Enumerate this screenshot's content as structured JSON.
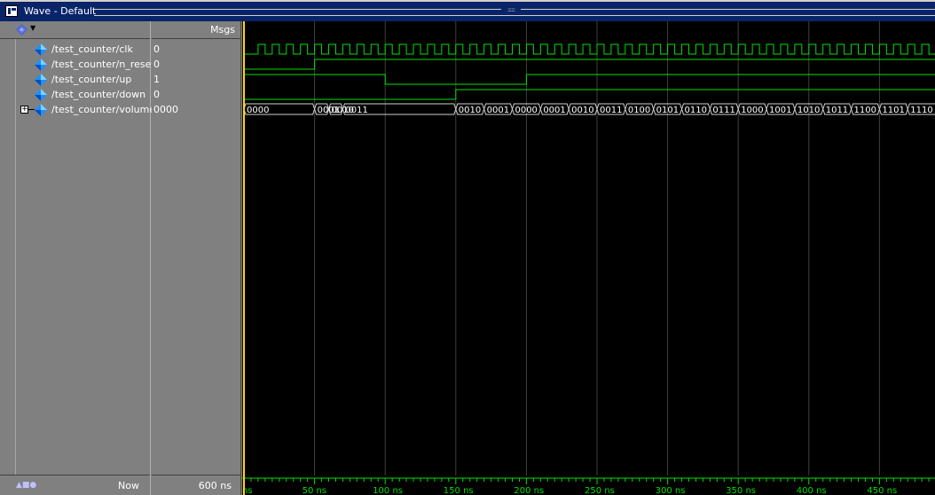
{
  "window": {
    "title": "Wave - Default",
    "grip": "::::::"
  },
  "header": {
    "msgs_label": "Msgs"
  },
  "signals": [
    {
      "name": "/test_counter/clk",
      "value": "0",
      "expandable": false
    },
    {
      "name": "/test_counter/n_reset",
      "value": "0",
      "expandable": false
    },
    {
      "name": "/test_counter/up",
      "value": "1",
      "expandable": false
    },
    {
      "name": "/test_counter/down",
      "value": "0",
      "expandable": false
    },
    {
      "name": "/test_counter/volume",
      "value": "0000",
      "expandable": true
    }
  ],
  "footer": {
    "now_label": "Now",
    "now_value": "600 ns"
  },
  "timeline": {
    "unit": "ns",
    "view_start_ns": 0,
    "ns_per_grid": 50,
    "tick_labels": [
      "ns",
      "50 ns",
      "100 ns",
      "150 ns",
      "200 ns",
      "250 ns",
      "300 ns",
      "350 ns",
      "400 ns",
      "450 ns"
    ],
    "cursor_ns": 0
  },
  "waveforms": {
    "clk_period_ns": 10,
    "clk_first_rise_ns": 0,
    "n_reset_edges": [
      {
        "t": 0,
        "v": 0
      },
      {
        "t": 50,
        "v": 1
      }
    ],
    "up_edges": [
      {
        "t": 0,
        "v": 1
      },
      {
        "t": 100,
        "v": 0
      },
      {
        "t": 200,
        "v": 1
      }
    ],
    "down_edges": [
      {
        "t": 0,
        "v": 0
      },
      {
        "t": 150,
        "v": 1
      }
    ],
    "volume_segments": [
      {
        "t": 0,
        "v": "0000"
      },
      {
        "t": 50,
        "v": "0001"
      },
      {
        "t": 60,
        "v": "0010"
      },
      {
        "t": 70,
        "v": "0011"
      },
      {
        "t": 150,
        "v": "0010"
      },
      {
        "t": 170,
        "v": "0001"
      },
      {
        "t": 190,
        "v": "0000"
      },
      {
        "t": 210,
        "v": "0001"
      },
      {
        "t": 230,
        "v": "0010"
      },
      {
        "t": 250,
        "v": "0011"
      },
      {
        "t": 270,
        "v": "0100"
      },
      {
        "t": 290,
        "v": "0101"
      },
      {
        "t": 310,
        "v": "0110"
      },
      {
        "t": 330,
        "v": "0111"
      },
      {
        "t": 350,
        "v": "1000"
      },
      {
        "t": 370,
        "v": "1001"
      },
      {
        "t": 390,
        "v": "1010"
      },
      {
        "t": 410,
        "v": "1011"
      },
      {
        "t": 430,
        "v": "1100"
      },
      {
        "t": 450,
        "v": "1101"
      },
      {
        "t": 470,
        "v": "1110"
      }
    ]
  },
  "colors": {
    "wave": "#00e000",
    "grid": "#404040",
    "cursor": "#ffd700",
    "bus_text": "#ffffff",
    "background": "#000000"
  },
  "icons": {
    "window": "wave-window-icon",
    "signal": "signal-diamond-icon",
    "header": "wave-menu-icon"
  }
}
